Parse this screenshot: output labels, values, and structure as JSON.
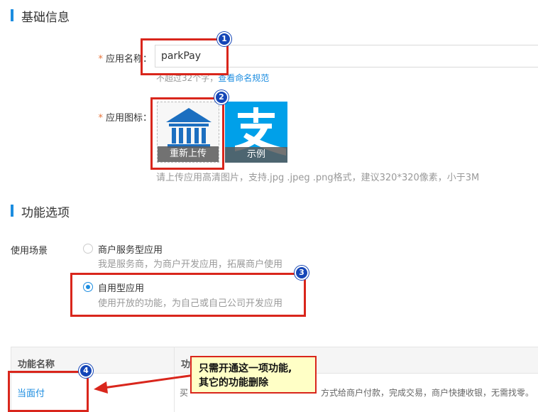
{
  "basic_info": {
    "title": "基础信息",
    "app_name_label": "应用名称：",
    "app_name_value": "parkPay",
    "name_hint": "不超过32个字，",
    "name_rule_link": "查看命名规范",
    "app_icon_label": "应用图标：",
    "reupload_label": "重新上传",
    "example_label": "示例",
    "icon_hint": "请上传应用高清图片，支持.jpg .jpeg .png格式，建议320*320像素，小于3M"
  },
  "function_options": {
    "title": "功能选项",
    "scenario_label": "使用场景",
    "options": [
      {
        "title": "商户服务型应用",
        "desc": "我是服务商，为商户开发应用，拓展商户使用",
        "checked": false
      },
      {
        "title": "自用型应用",
        "desc": "使用开放的功能，为自己或自己公司开发应用",
        "checked": true
      }
    ]
  },
  "table": {
    "col_name": "功能名称",
    "col_desc": "功",
    "rows": [
      {
        "name": "当面付",
        "desc_left": "买",
        "desc_right": "方式给商户付款，完成交易，商户快捷收银，无需找零。"
      }
    ]
  },
  "annotations": {
    "badges": [
      "1",
      "2",
      "3",
      "4"
    ],
    "callout_line1": "只需开通这一项功能,",
    "callout_line2": "其它的功能删除"
  },
  "colors": {
    "accent": "#1c8de0",
    "annotation_red": "#d9261c",
    "badge_blue": "#1546b7",
    "alipay_blue": "#00a0e9",
    "callout_bg": "#ffffc6"
  }
}
